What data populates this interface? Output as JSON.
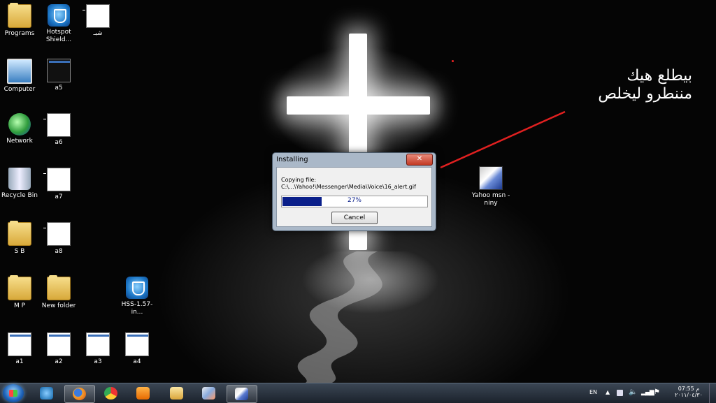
{
  "desktop": {
    "icons": [
      {
        "label": "Programs",
        "icon": "folder-icon"
      },
      {
        "label": "Hotspot Shield...",
        "icon": "hotspot-shield-icon"
      },
      {
        "label": "شبـ",
        "icon": "window-thumbnail-icon"
      },
      {
        "label": "Computer",
        "icon": "computer-icon"
      },
      {
        "label": "a5",
        "icon": "cross-thumbnail-icon"
      },
      {
        "label": "Network",
        "icon": "network-icon"
      },
      {
        "label": "a6",
        "icon": "window-thumbnail-icon"
      },
      {
        "label": "Recycle Bin",
        "icon": "recycle-bin-icon"
      },
      {
        "label": "a7",
        "icon": "window-thumbnail-icon"
      },
      {
        "label": "S B",
        "icon": "folder-icon"
      },
      {
        "label": "a8",
        "icon": "window-thumbnail-icon"
      },
      {
        "label": "M P",
        "icon": "folder-icon"
      },
      {
        "label": "New folder",
        "icon": "folder-icon"
      },
      {
        "label": "HSS-1.57-in...",
        "icon": "hotspot-shield-icon"
      },
      {
        "label": "a1",
        "icon": "screenshot-thumbnail-icon"
      },
      {
        "label": "a2",
        "icon": "screenshot-thumbnail-icon"
      },
      {
        "label": "a3",
        "icon": "screenshot-thumbnail-icon"
      },
      {
        "label": "a4",
        "icon": "screenshot-thumbnail-icon"
      },
      {
        "label": "Yahoo msn - niny",
        "icon": "installer-icon"
      }
    ],
    "annotation": {
      "line1": "بيطلع هيك",
      "line2": "مننطرو ليخلص",
      "color": "#e02020"
    }
  },
  "dialog": {
    "title": "Installing",
    "close_label": "✕",
    "copy_label": "Copying file:",
    "copy_path": "C:\\...\\Yahoo!\\Messenger\\Media\\Voice\\16_alert.gif",
    "progress_percent": 27,
    "progress_text": "27%",
    "cancel_label": "Cancel"
  },
  "taskbar": {
    "apps": [
      {
        "name": "internet-explorer-icon",
        "active": false
      },
      {
        "name": "firefox-icon",
        "active": true
      },
      {
        "name": "chrome-icon",
        "active": false
      },
      {
        "name": "media-player-icon",
        "active": false
      },
      {
        "name": "file-explorer-icon",
        "active": false
      },
      {
        "name": "image-viewer-icon",
        "active": false
      },
      {
        "name": "installer-icon",
        "active": true
      }
    ],
    "tray": {
      "language": "EN",
      "time": "07:55 م",
      "date": "٢٠١١/٠٤/٣٠"
    }
  }
}
